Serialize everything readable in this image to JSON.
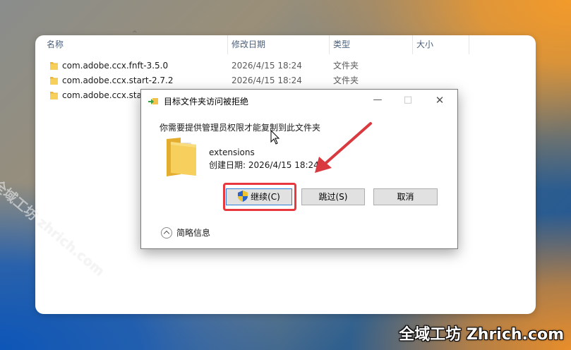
{
  "explorer": {
    "columns": {
      "name": "名称",
      "modified": "修改日期",
      "type": "类型",
      "size": "大小"
    },
    "rows": [
      {
        "name": "com.adobe.ccx.fnft-3.5.0",
        "modified": "2026/4/15 18:24",
        "type": "文件夹"
      },
      {
        "name": "com.adobe.ccx.start-2.7.2",
        "modified": "2026/4/15 18:24",
        "type": "文件夹"
      },
      {
        "name": "com.adobe.ccx.start",
        "modified": "",
        "type": ""
      }
    ]
  },
  "dialog": {
    "title": "目标文件夹访问被拒绝",
    "message": "你需要提供管理员权限才能复制到此文件夹",
    "folder_name": "extensions",
    "created": "创建日期: 2026/4/15 18:24",
    "buttons": {
      "continue": "继续(C)",
      "skip": "跳过(S)",
      "cancel": "取消"
    },
    "details": "简略信息",
    "window_controls": {
      "minimize": "—",
      "maximize": "□",
      "close": "✕"
    }
  },
  "watermark": {
    "diagonal": "全域工坊 zhrich.com",
    "corner": "全域工坊 Zhrich.com"
  },
  "colors": {
    "highlight": "#e8373f",
    "arrow": "#d93a3f",
    "folder": "#f4c542",
    "accent": "#2f7fd7"
  }
}
